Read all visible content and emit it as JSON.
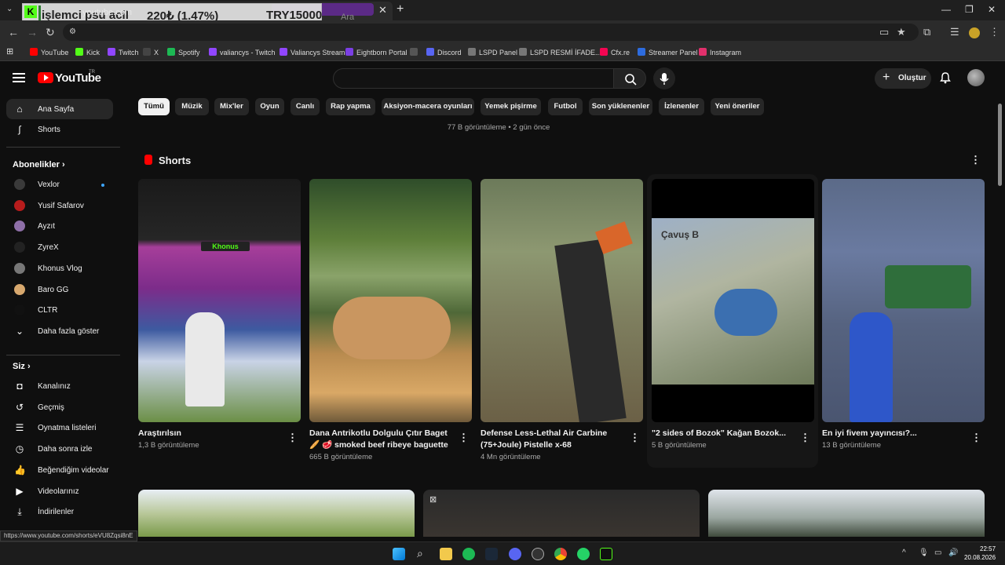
{
  "overlay": {
    "text1": "işlemci psu acil",
    "text2": "220₺ (1.47%)",
    "text3": "TRY15000"
  },
  "browser": {
    "url": "youtube.com",
    "bookmarks": [
      {
        "label": "YouTube",
        "color": "#ff0000"
      },
      {
        "label": "Kick",
        "color": "#53fc18"
      },
      {
        "label": "Twitch",
        "color": "#9146ff"
      },
      {
        "label": "X",
        "color": "#444444"
      },
      {
        "label": "Spotify",
        "color": "#1db954"
      },
      {
        "label": "valiancys - Twitch",
        "color": "#9146ff"
      },
      {
        "label": "Valiancys Stream",
        "color": "#9146ff"
      },
      {
        "label": "Eightborn Portal",
        "color": "#7b3fe4"
      },
      {
        "label": "",
        "color": "#555555"
      },
      {
        "label": "Discord",
        "color": "#5865f2"
      },
      {
        "label": "LSPD Panel",
        "color": "#777777"
      },
      {
        "label": "LSPD  RESMİ İFADE...",
        "color": "#777777"
      },
      {
        "label": "Cfx.re",
        "color": "#f40552"
      },
      {
        "label": "Streamer Panel",
        "color": "#2d6cdf"
      },
      {
        "label": "Instagram",
        "color": "#e1306c"
      }
    ]
  },
  "header": {
    "logo": "YouTube",
    "region": "TR",
    "search_placeholder": "Ara",
    "create_label": "Oluştur"
  },
  "sidebar": {
    "main": [
      {
        "label": "Ana Sayfa",
        "icon": "home-icon"
      },
      {
        "label": "Shorts",
        "icon": "shorts-icon"
      }
    ],
    "subs_heading": "Abonelikler",
    "subs": [
      {
        "label": "Vexlor",
        "color": "#3a3a3a"
      },
      {
        "label": "Yusif Safarov",
        "color": "#b71c1c"
      },
      {
        "label": "Ayzıt",
        "color": "#8e6fa8"
      },
      {
        "label": "ZyreX",
        "color": "#222222"
      },
      {
        "label": "Khonus Vlog",
        "color": "#777777"
      },
      {
        "label": "Baro GG",
        "color": "#d7a86e"
      },
      {
        "label": "CLTR",
        "color": "#111111"
      },
      {
        "label": "Daha fazla göster",
        "color": ""
      }
    ],
    "you_heading": "Siz",
    "you": [
      {
        "label": "Kanalınız",
        "icon": "user-icon"
      },
      {
        "label": "Geçmiş",
        "icon": "history-icon"
      },
      {
        "label": "Oynatma listeleri",
        "icon": "playlist-icon"
      },
      {
        "label": "Daha sonra izle",
        "icon": "clock-icon"
      },
      {
        "label": "Beğendiğim videolar",
        "icon": "thumbs-up-icon"
      },
      {
        "label": "Videolarınız",
        "icon": "video-icon"
      },
      {
        "label": "İndirilenler",
        "icon": "download-icon"
      }
    ]
  },
  "chips": [
    "Tümü",
    "Müzik",
    "Mix'ler",
    "Oyun",
    "Canlı",
    "Rap yapma",
    "Aksiyon-macera oyunları",
    "Yemek pişirme",
    "Futbol",
    "Son yüklenenler",
    "İzlenenler",
    "Yeni öneriler"
  ],
  "meta_line": "77 B görüntüleme • 2 gün önce",
  "shorts": {
    "title": "Shorts",
    "items": [
      {
        "title": "Araştırılsın",
        "views": "1,3 B görüntüleme",
        "badge": "Khonus"
      },
      {
        "title": "Dana Antrikotlu Dolgulu Çıtır Baget 🥖 🥩 smoked beef ribeye baguette",
        "views": "665 B görüntüleme",
        "badge": ""
      },
      {
        "title": "Defense Less-Lethal Air Carbine (75+Joule) Pistelle x-68",
        "views": "4 Mn görüntüleme",
        "badge": ""
      },
      {
        "title": "\"2 sides of Bozok\" Kağan Bozok...",
        "views": "5 B görüntüleme",
        "badge": "Çavuş B"
      },
      {
        "title": "En iyi fivem yayıncısı?...",
        "views": "13 B görüntüleme",
        "badge": ""
      }
    ]
  },
  "status_url": "https://www.youtube.com/shorts/eVU8Zqsi8nE",
  "taskbar": {
    "time": "22:57",
    "date": "20.08.2026"
  }
}
